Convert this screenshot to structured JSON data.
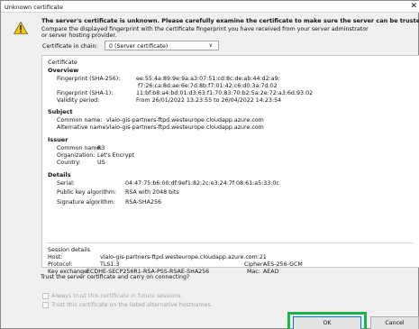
{
  "window": {
    "title": "Unknown certificate",
    "close_glyph": "✕"
  },
  "message": {
    "line1": "The server's certificate is unknown. Please carefully examine the certificate to make sure the server can be trusted.",
    "line2": "Compare the displayed fingerprint with the certificate fingerprint you have received from your server adminstrator",
    "line3": "or server hosting provider."
  },
  "chain": {
    "label": "Certificate in chain:",
    "selected": "0 (Server certificate)"
  },
  "certificate": {
    "group_label": "Certificate",
    "overview": {
      "heading": "Overview",
      "fp256_label": "Fingerprint (SHA-256):",
      "fp256_line1": "ee:55:4a:89:9e:9a:a3:07:51:cd:8c:de:ab:44:d2:a9:",
      "fp256_line2": "f7:26:ca:8d:ae:6e:7d:8b:f7:01:42:c6:d0:3a:7d:02",
      "fp1_label": "Fingerprint (SHA-1):",
      "fp1_value": "11:bf:b8:a4:bd:01:d3:63:f1:70:83:70:b2:5a:2e:72:a3:6d:93:02",
      "validity_label": "Validity period:",
      "validity_value": "From 26/01/2022 13:23:55 to 26/04/2022 14:23:54"
    },
    "subject": {
      "heading": "Subject",
      "cn_label": "Common name:",
      "cn_value": "vlaio-gis-partners-ftpd.westeurope.cloudapp.azure.com",
      "alt_label": "Alternative name:",
      "alt_value": "vlaio-gis-partners-ftpd.westeurope.cloudapp.azure.com"
    },
    "issuer": {
      "heading": "Issuer",
      "cn_label": "Common name:",
      "cn_value": "R3",
      "org_label": "Organization:",
      "org_value": "Let's Encrypt",
      "country_label": "Country:",
      "country_value": "US"
    },
    "details": {
      "heading": "Details",
      "serial_label": "Serial:",
      "serial_value": "04:47:75:b6:00:df:9ef1:82:2c:e3:24:7f:08:61:a5:33:0c",
      "pk_label": "Public key algorithm:",
      "pk_value": "RSA with 2048 bits",
      "sig_label": "Signature algorithm:",
      "sig_value": "RSA-SHA256"
    }
  },
  "session": {
    "heading": "Session details",
    "host_label": "Host:",
    "host_value": "vlaio-gis-partners-ftpd.westeurope.cloudapp.azure.com:21",
    "protocol_label": "Protocol:",
    "protocol_value": "TLS1.3",
    "cipher_label": "Cipher:",
    "cipher_value": "AES-256-GCM",
    "kx_label": "Key exchange:",
    "kx_value": "ECDHE-SECP256R1-RSA-PSS-RSAE-SHA256",
    "mac_label": "Mac:",
    "mac_value": "AEAD"
  },
  "trust": {
    "question": "Trust the server certificate and carry on connecting?",
    "always_label": "Always trust this certificate in future sessions.",
    "alt_label": "Trust this certificate on the listed alternative hostnames."
  },
  "buttons": {
    "ok": "OK",
    "cancel": "Cancel"
  },
  "colors": {
    "ok_highlight": "#1ab24b",
    "warning_yellow": "#f7c600"
  },
  "icons": {
    "warning": "warning-icon",
    "dropdown": "chevron-down-icon",
    "close": "close-icon"
  }
}
